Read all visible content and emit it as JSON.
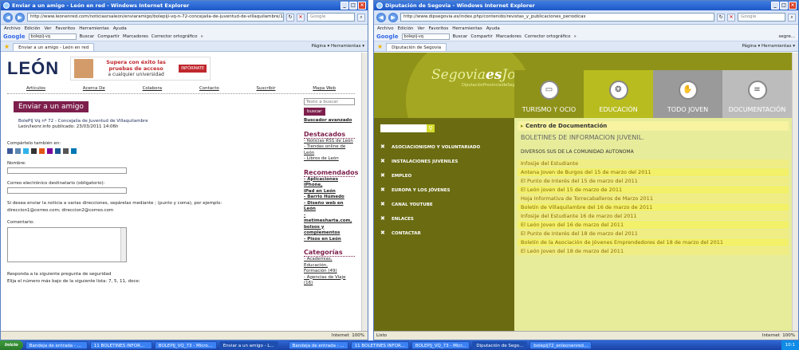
{
  "w1": {
    "title": "Enviar a un amigo - León en red - Windows Internet Explorer",
    "url": "http://www.leonenred.com/noticiasrsaleon/enviaramigo/bolepiji-vq-n-72-concejalia-de-juventud-de-villaquilambre/167085/now",
    "search_placeholder": "Google",
    "menu": [
      "Archivo",
      "Edición",
      "Ver",
      "Favoritos",
      "Herramientas",
      "Ayuda"
    ],
    "gbar": {
      "logo": "Google",
      "query": "bolepij-vq",
      "buscar": "Buscar",
      "compartir": "Compartir",
      "marcadores": "Marcadores",
      "corrector": "Corrector ortográfico",
      "more": "»"
    },
    "tab": "Enviar a un amigo - León en red",
    "tools": "Página ▾  Herramientas ▾",
    "page": {
      "logo": "LEÓN",
      "ad_title": "Supera con éxito las pruebas de acceso",
      "ad_sub": "a cualquier universidad",
      "ad_btn": "INFÓRMATE",
      "nav": [
        "Artículos",
        "Acerca De",
        "Colabora",
        "Contacto",
        "Suscribir",
        "Mapa Web"
      ],
      "heading": "Enviar a un amigo",
      "item_title": "BolePIJ Vq nº 72 - Concejalía de Juventud de Villaquilambre",
      "item_meta": "León/leonr.info publicado: 23/03/2011 14:06h",
      "share": "Compártelo también en:",
      "name_label": "Nombre:",
      "email_label": "Correo electrónico destinatario (obligatorio):",
      "multi_label": "Si desea enviar la noticia a varias direcciones, sepárelas mediante ; (punto y coma), por ejemplo:",
      "multi_example": "direccion1@correo.com; direccion2@correo.com",
      "comment_label": "Comentario:",
      "security_q": "Responda a la siguiente pregunta de seguridad",
      "security_detail": "Elija el número más bajo de la siguiente lista: 7, 5, 11, doce:",
      "search_placeholder": "Texto a buscar",
      "search_btn": "buscar",
      "adv_search": "Buscador avanzado",
      "dest_title": "Destacados",
      "dest_items": [
        "- Noticias RSS de León",
        "- Tiendas online de",
        "León",
        "- Libros de León"
      ],
      "rec_title": "Recomendados",
      "rec_items": [
        "- Aplicaciones iPhone,",
        "iPad en León",
        "- Barrio Húmedo",
        "- Diseño web en León",
        "- metimesharta.com,",
        "bolsos y complementos",
        "- Pisos en León"
      ],
      "cat_title": "Categorías",
      "cat_items": [
        "- Academias, Educación,",
        "Formación (49)",
        "- Agencias de Viaje (16)"
      ]
    },
    "status_right": "Internet",
    "zoom": "100%"
  },
  "w2": {
    "title": "Diputación de Segovia - Windows Internet Explorer",
    "url": "http://www.dipsegovia.es/index.php/contenido/revistas_y_publicaciones_periodicas",
    "search_placeholder": "Google",
    "menu": [
      "Archivo",
      "Edición",
      "Ver",
      "Favoritos",
      "Herramientas",
      "Ayuda"
    ],
    "gbar": {
      "logo": "Google",
      "query": "bolepij-vq",
      "buscar": "Buscar",
      "compartir": "Compartir",
      "marcadores": "Marcadores",
      "corrector": "Corrector ortográfico",
      "more": "»",
      "extra": "segre..."
    },
    "tab": "Diputación de Segovia",
    "tools": "Página ▾  Herramientas ▾",
    "page": {
      "logo_a": "Segovia",
      "logo_b": "es",
      "logo_c": "Joven",
      "logo_sub": "DiputaciónProvincialdeSegovia",
      "cats": [
        "TURISMO Y OCIO",
        "EDUCACIÓN",
        "TODO JOVEN",
        "DOCUMENTACIÓN"
      ],
      "menu": [
        "ASOCIACIONISMO Y VOLUNTARIADO",
        "INSTALACIONES JUVENILES",
        "EMPLEO",
        "EUROPA Y LOS JÓVENES",
        "CANAL YOUTUBE",
        "ENLACES",
        "CONTACTAR"
      ],
      "centro": "Centro de Documentación",
      "boletines": "BOLETINES DE INFORMACION JUVENIL.",
      "diversos": "DIVERSOS SUS DE LA COMUNIDAD AUTONOMA",
      "links": [
        "Infosije del Estudiante",
        "Antena Joven de Burgos del 15 de marzo del 2011",
        "El Punto de Interés del 15 de marzo del 2011",
        "El León joven del 15 de marzo de 2011",
        "Hoja Informativa de Torrecaballeros de Marzo 2011",
        "Boletín de Villaquilambre del 16 de marzo de 2011",
        "Infosije del Estudiante 16 de marzo del 2011",
        "El León Joven del 16 de marzo del 2011",
        "El Punto de Interés del 18 de marzo del 2011",
        "Boletín de la Asociación de Jóvenes Emprendedores del 18 de marzo del 2011",
        "El León Joven del 18 de marzo del 2011"
      ]
    },
    "status_left": "Listo",
    "status_right": "Internet",
    "zoom": "100%"
  },
  "taskbar": {
    "start": "Inicio",
    "items": [
      "Bandeja de entrada - Mic...",
      "11 BOLETINES INFORMA...",
      "BOLEPIJ_VQ_73 - Micros...",
      "Enviar a un amigo - L...",
      "Bandeja de entrada - ...",
      "11 BOLETINES INFOR...",
      "BOLEPIJ_VQ_73 - Micr...",
      "Diputación de Sego...",
      "bolepij72_enleonenred..."
    ],
    "clock1": "10:16",
    "clock2": "10:1"
  }
}
